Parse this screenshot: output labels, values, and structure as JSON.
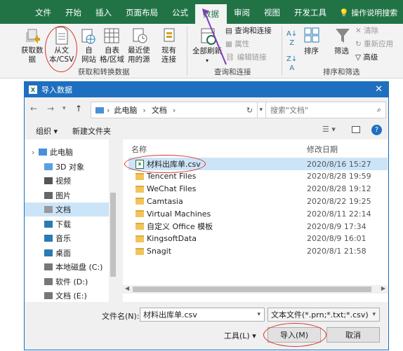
{
  "menu": {
    "tabs": [
      "文件",
      "开始",
      "插入",
      "页面布局",
      "公式",
      "数据",
      "审阅",
      "视图",
      "开发工具"
    ],
    "active": "数据",
    "tell_me": "操作说明搜索"
  },
  "ribbon": {
    "get_data": "获取数\n据",
    "from_text_csv": "从文\n本/CSV",
    "from_web": "自\n网站",
    "from_table": "自表\n格/区域",
    "recent_sources": "最近使\n用的源",
    "existing_conn": "现有\n连接",
    "refresh_all": "全部刷新",
    "queries_conn": "查询和连接",
    "properties": "属性",
    "edit_links": "编辑链接",
    "sort": "排序",
    "filter": "筛选",
    "clear": "清除",
    "reapply": "重新应用",
    "advanced": "高级",
    "group_get": "获取和转换数据",
    "group_query": "查询和连接",
    "group_sort": "排序和筛选"
  },
  "dialog": {
    "title": "导入数据",
    "address": [
      "此电脑",
      "文档"
    ],
    "search_placeholder": "搜索\"文档\"",
    "organize": "组织",
    "new_folder": "新建文件夹",
    "col_name": "名称",
    "col_date": "修改日期",
    "tree": [
      {
        "label": "此电脑",
        "icon": "pc-icon"
      },
      {
        "label": "3D 对象",
        "icon": "3d-icon"
      },
      {
        "label": "视频",
        "icon": "video-icon"
      },
      {
        "label": "图片",
        "icon": "picture-icon"
      },
      {
        "label": "文档",
        "icon": "document-icon"
      },
      {
        "label": "下载",
        "icon": "download-icon"
      },
      {
        "label": "音乐",
        "icon": "music-icon"
      },
      {
        "label": "桌面",
        "icon": "desktop-icon"
      },
      {
        "label": "本地磁盘 (C:)",
        "icon": "disk-icon"
      },
      {
        "label": "软件 (D:)",
        "icon": "disk-icon"
      },
      {
        "label": "文档 (E:)",
        "icon": "disk-icon"
      }
    ],
    "files": [
      {
        "name": "材料出库单.csv",
        "date": "2020/8/16 15:27",
        "type": "csv"
      },
      {
        "name": "Tencent Files",
        "date": "2020/8/28 19:59",
        "type": "folder"
      },
      {
        "name": "WeChat Files",
        "date": "2020/8/28 19:12",
        "type": "folder"
      },
      {
        "name": "Camtasia",
        "date": "2020/8/22 19:25",
        "type": "folder"
      },
      {
        "name": "Virtual Machines",
        "date": "2020/8/11 22:14",
        "type": "folder"
      },
      {
        "name": "自定义 Office 模板",
        "date": "2020/8/9 17:34",
        "type": "folder"
      },
      {
        "name": "KingsoftData",
        "date": "2020/8/9 16:01",
        "type": "folder"
      },
      {
        "name": "Snagit",
        "date": "2020/8/1 21:58",
        "type": "folder"
      }
    ],
    "filename_label": "文件名(N):",
    "filename_value": "材料出库单.csv",
    "filetype_value": "文本文件(*.prn;*.txt;*.csv)",
    "tools": "工具(L)",
    "import": "导入(M)",
    "cancel": "取消"
  }
}
